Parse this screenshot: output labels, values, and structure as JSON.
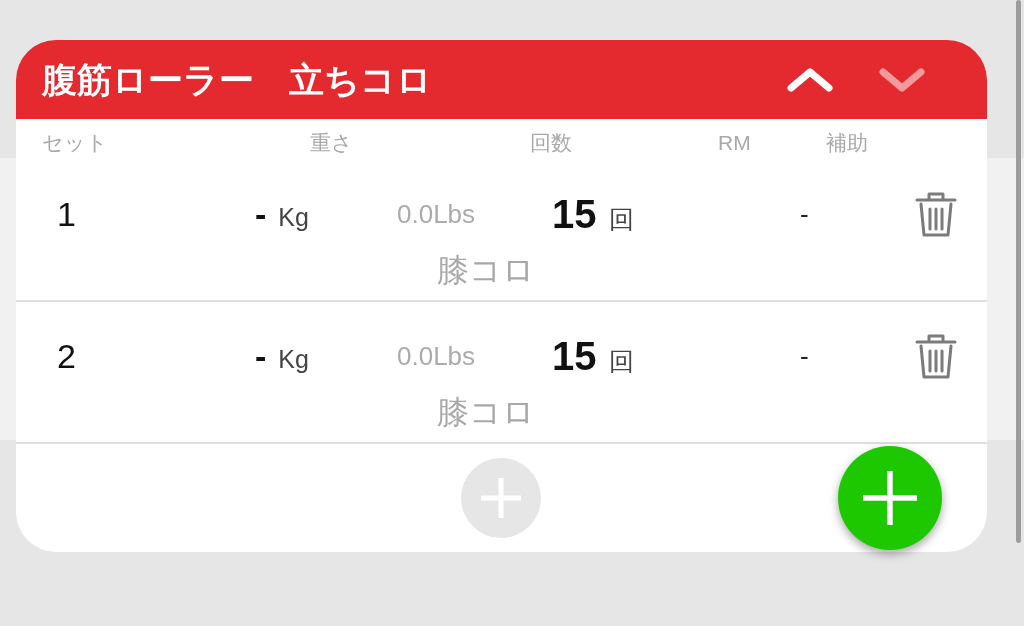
{
  "card": {
    "title": "腹筋ローラー　立ちコロ",
    "arrows": [
      {
        "kind": "up",
        "disabled": false
      },
      {
        "kind": "down",
        "disabled": true
      }
    ]
  },
  "columns": [
    "セット",
    "重さ",
    "回数",
    "RM",
    "補助"
  ],
  "rows": [
    {
      "set": "1",
      "weight": "-",
      "weight_unit": "Kg",
      "pounds": "0.0Lbs",
      "reps": "15",
      "reps_unit": "回",
      "assist": "-",
      "note": "膝コロ"
    },
    {
      "set": "2",
      "weight": "-",
      "weight_unit": "Kg",
      "pounds": "0.0Lbs",
      "reps": "15",
      "reps_unit": "回",
      "assist": "-",
      "note": "膝コロ"
    }
  ],
  "footer": {
    "buttons": [
      {
        "kind": "inline"
      },
      {
        "kind": "floating"
      }
    ]
  }
}
